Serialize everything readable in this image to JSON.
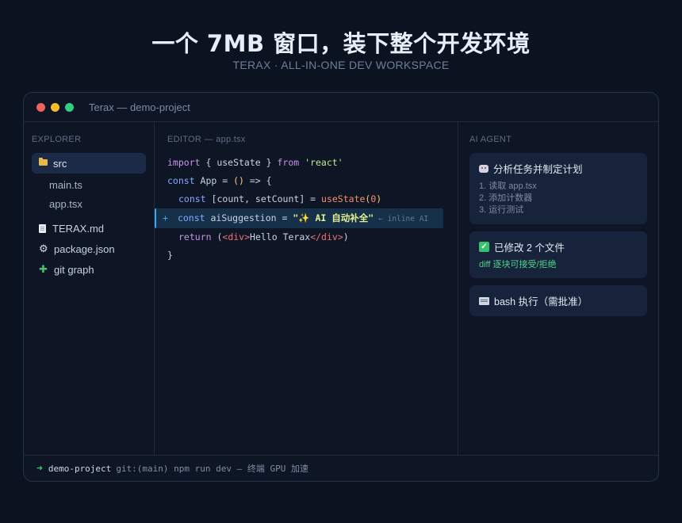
{
  "hero": {
    "title": "一个 7MB 窗口，装下整个开发环境",
    "subtitle": "TERAX · ALL-IN-ONE DEV WORKSPACE"
  },
  "window": {
    "title": "Terax — demo-project"
  },
  "explorer": {
    "label": "EXPLORER",
    "folder": "src",
    "children": [
      "main.ts",
      "app.tsx"
    ],
    "files": [
      {
        "name": "TERAX.md",
        "icon": "document-icon"
      },
      {
        "name": "package.json",
        "icon": "gear-icon"
      },
      {
        "name": "git graph",
        "icon": "puzzle-icon"
      }
    ]
  },
  "editor": {
    "label": "EDITOR — app.tsx",
    "line1": {
      "k1": "import",
      "p1": " { useState } ",
      "k2": "from",
      "p2": " ",
      "s": "'react'"
    },
    "line2": {
      "k": "const",
      "p1": " App = ",
      "paren": "()",
      "p2": " => {"
    },
    "line3": {
      "k": "const",
      "p1": " [count, setCount] = ",
      "fn": "useState",
      "o": "(",
      "n": "0",
      "c": ")"
    },
    "line4": {
      "plus": "+",
      "k": "const",
      "p1": " aiSuggestion = ",
      "s": "\"✨ AI 自动补全\"",
      "hint": "← inline AI"
    },
    "line5": {
      "k": "return",
      "p1": " (",
      "t1": "<div>",
      "txt": "Hello Terax",
      "t2": "</div>",
      "p2": ")"
    },
    "line6": "}"
  },
  "agent": {
    "label": "AI AGENT",
    "card1": {
      "title": "分析任务并制定计划",
      "steps": [
        "1. 读取 app.tsx",
        "2. 添加计数器",
        "3. 运行测试"
      ]
    },
    "card2": {
      "title": "已修改 2 个文件",
      "note": "diff 逐块可接受/拒绝"
    },
    "card3": {
      "title": "bash 执行（需批准）"
    }
  },
  "statusbar": {
    "arrow": "➜",
    "project": "demo-project",
    "command": "git:(main) npm run dev — 终端 GPU 加速"
  }
}
